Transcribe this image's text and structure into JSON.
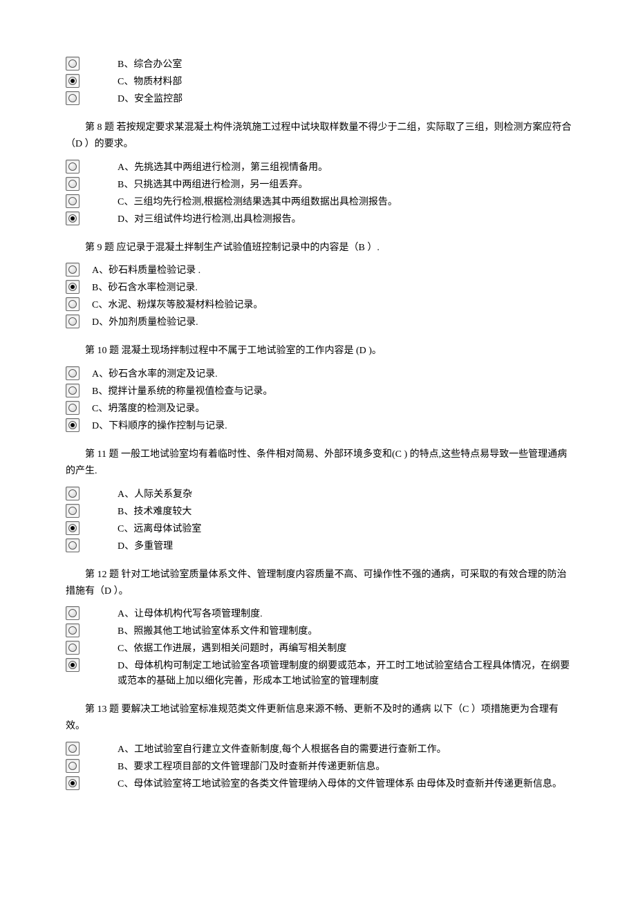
{
  "q7_tail": {
    "options": [
      {
        "label": "B、综合办公室",
        "selected": false
      },
      {
        "label": "C、物质材料部",
        "selected": true
      },
      {
        "label": "D、安全监控部",
        "selected": false
      }
    ]
  },
  "q8": {
    "text": "第 8 题 若按规定要求某混凝土构件浇筑施工过程中试块取样数量不得少于二组，实际取了三组，则检测方案应符合（D ）的要求。",
    "options": [
      {
        "label": "A、先挑选其中两组进行检测，第三组视情备用。",
        "selected": false
      },
      {
        "label": "B、只挑选其中两组进行检测，另一组丢弃。",
        "selected": false
      },
      {
        "label": "C、三组均先行检测,根据检测结果选其中两组数据出具检测报告。",
        "selected": false
      },
      {
        "label": "D、对三组试件均进行检测,出具检测报告。",
        "selected": true
      }
    ]
  },
  "q9": {
    "text": "第 9 题 应记录于混凝土拌制生产试验值班控制记录中的内容是（B ）.",
    "options": [
      {
        "label": "A、砂石料质量检验记录 .",
        "selected": false
      },
      {
        "label": "B、砂石含水率检测记录.",
        "selected": true
      },
      {
        "label": "C、水泥、粉煤灰等胶凝材料检验记录。",
        "selected": false
      },
      {
        "label": "D、外加剂质量检验记录.",
        "selected": false
      }
    ]
  },
  "q10": {
    "text": "第 10 题 混凝土现场拌制过程中不属于工地试验室的工作内容是 (D )。",
    "options": [
      {
        "label": "A、砂石含水率的测定及记录.",
        "selected": false
      },
      {
        "label": "B、搅拌计量系统的称量视值检查与记录。",
        "selected": false
      },
      {
        "label": "C、坍落度的检测及记录。",
        "selected": false
      },
      {
        "label": "D、下料顺序的操作控制与记录.",
        "selected": true
      }
    ]
  },
  "q11": {
    "text": "第 11 题 一般工地试验室均有着临时性、条件相对简易、外部环境多变和(C  ) 的特点,这些特点易导致一些管理通病的产生.",
    "options": [
      {
        "label": "A、人际关系复杂",
        "selected": false
      },
      {
        "label": "B、技术难度较大",
        "selected": false
      },
      {
        "label": "C、远离母体试验室",
        "selected": true
      },
      {
        "label": "D、多重管理",
        "selected": false
      }
    ]
  },
  "q12": {
    "text": "第 12 题 针对工地试验室质量体系文件、管理制度内容质量不高、可操作性不强的通病，可采取的有效合理的防治措施有（D ）。",
    "options": [
      {
        "label": "A、让母体机构代写各项管理制度.",
        "selected": false
      },
      {
        "label": "B、照搬其他工地试验室体系文件和管理制度。",
        "selected": false
      },
      {
        "label": "C、依据工作进展，遇到相关问题时，再编写相关制度",
        "selected": false
      },
      {
        "label": "D、母体机构可制定工地试验室各项管理制度的纲要或范本，开工时工地试验室结合工程具体情况，在纲要或范本的基础上加以细化完善，形成本工地试验室的管理制度",
        "selected": true
      }
    ]
  },
  "q13": {
    "text": "第 13 题 要解决工地试验室标准规范类文件更新信息来源不畅、更新不及时的通病 以下（C ）项措施更为合理有效。",
    "options": [
      {
        "label": "A、工地试验室自行建立文件查新制度,每个人根据各自的需要进行查新工作。",
        "selected": false
      },
      {
        "label": "B、要求工程项目部的文件管理部门及时查新并传递更新信息。",
        "selected": false
      },
      {
        "label": "C、母体试验室将工地试验室的各类文件管理纳入母体的文件管理体系 由母体及时查新并传递更新信息。",
        "selected": true
      }
    ]
  }
}
